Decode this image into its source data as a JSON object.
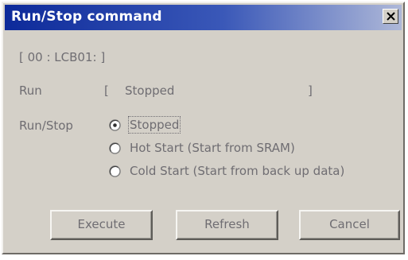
{
  "window": {
    "title": "Run/Stop command",
    "close_icon": "close-icon"
  },
  "station": {
    "id_label": "[ 00 : LCB01: ]"
  },
  "run_status": {
    "label": "Run",
    "open_bracket": "[",
    "value": "Stopped",
    "close_bracket": "]"
  },
  "run_stop": {
    "label": "Run/Stop",
    "selected": "stopped",
    "options": [
      {
        "id": "stopped",
        "label": "Stopped"
      },
      {
        "id": "hot-start",
        "label": "Hot Start (Start from SRAM)"
      },
      {
        "id": "cold-start",
        "label": "Cold Start (Start from back up data)"
      }
    ]
  },
  "buttons": {
    "execute": "Execute",
    "refresh": "Refresh",
    "cancel": "Cancel"
  },
  "colors": {
    "title_bar_start": "#0d2a9a",
    "title_bar_end": "#aeb8d8",
    "dialog_face": "#d4d0c8"
  }
}
